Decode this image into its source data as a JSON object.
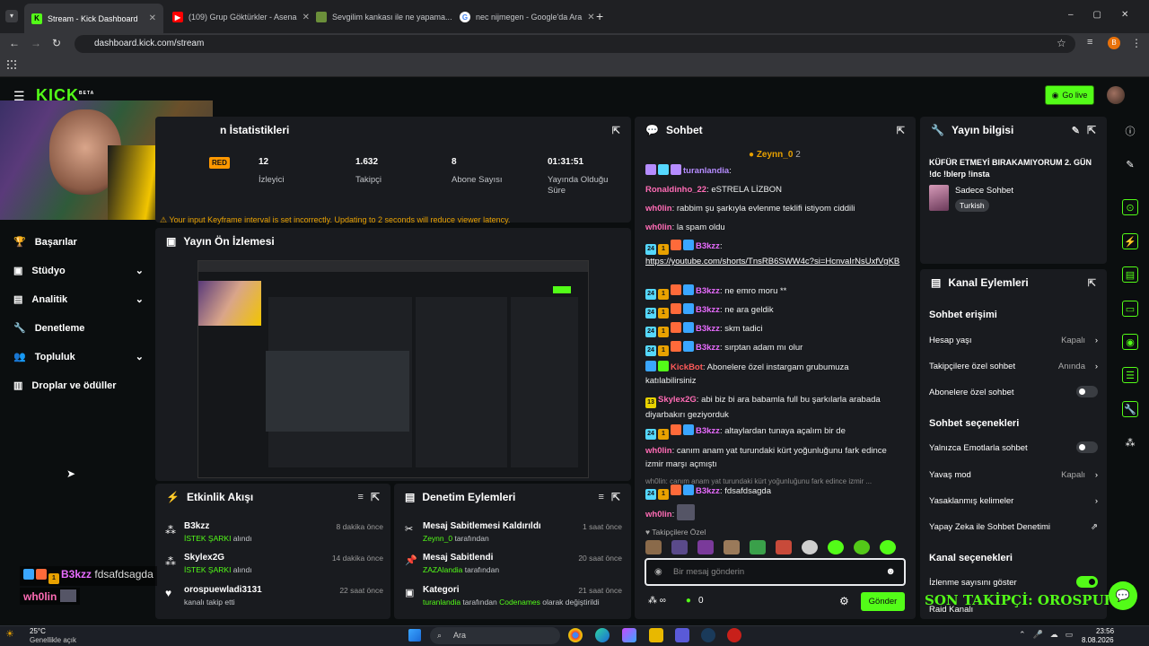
{
  "browser": {
    "tabs": [
      {
        "title": "Stream - Kick Dashboard",
        "active": true
      },
      {
        "title": "(109) Grup Göktürkler - Asena"
      },
      {
        "title": "Sevgilim kankası ile ne yapama..."
      },
      {
        "title": "nec nijmegen - Google'da Ara"
      }
    ],
    "url": "dashboard.kick.com/stream",
    "profile_initial": "B"
  },
  "header": {
    "logo": "KICK",
    "logo_sup": "BETA",
    "go_live": "Go live"
  },
  "sidebar": {
    "items": [
      {
        "label": "Başarılar"
      },
      {
        "label": "Stüdyo"
      },
      {
        "label": "Analitik"
      },
      {
        "label": "Denetleme"
      },
      {
        "label": "Topluluk"
      },
      {
        "label": "Droplar ve ödüller"
      }
    ]
  },
  "stats": {
    "title": "n İstatistikleri",
    "status": "RED",
    "items": [
      {
        "value": "12",
        "label": "İzleyici"
      },
      {
        "value": "1.632",
        "label": "Takipçi"
      },
      {
        "value": "8",
        "label": "Abone Sayısı"
      },
      {
        "value": "01:31:51",
        "label": "Yayında Olduğu Süre"
      }
    ],
    "warning": "Your input Keyframe interval is set incorrectly. Updating to 2 seconds will reduce viewer latency."
  },
  "preview": {
    "title": "Yayın Ön İzlemesi"
  },
  "activity": {
    "title": "Etkinlik Akışı",
    "rows": [
      {
        "name": "B3kzz",
        "time": "8 dakika önce",
        "hl": "İSTEK ŞARKI",
        "rest": " alındı"
      },
      {
        "name": "Skylex2G",
        "time": "14 dakika önce",
        "hl": "İSTEK ŞARKI",
        "rest": " alındı"
      },
      {
        "name": "orospuewladi3131",
        "time": "22 saat önce",
        "hl": "",
        "rest": "kanalı takip etti"
      }
    ]
  },
  "moderation": {
    "title": "Denetim Eylemleri",
    "rows": [
      {
        "name": "Mesaj Sabitlemesi Kaldırıldı",
        "time": "1 saat önce",
        "hl": "Zeynn_0",
        "rest": " tarafından"
      },
      {
        "name": "Mesaj Sabitlendi",
        "time": "20 saat önce",
        "hl": "ZAZAlandia",
        "rest": " tarafından"
      },
      {
        "name": "Kategori",
        "time": "21 saat önce",
        "hl": "turanlandia",
        "rest": " tarafından ",
        "hl2": "Codenames",
        "rest2": " olarak değiştirildi"
      }
    ]
  },
  "chat": {
    "title": "Sohbet",
    "pinned_user": "Zeynn_0",
    "pinned_count": "2",
    "messages": [
      {
        "user": "turanlandia",
        "text": ":",
        "color": "#b58cff"
      },
      {
        "user": "Ronaldinho_22",
        "text": ": eSTRELA LİZBON",
        "color": "#ff6cb5"
      },
      {
        "user": "wh0lin",
        "text": ": rabbim şu şarkıyla evlenme teklifi istiyom ciddili",
        "color": "#ff6cb5"
      },
      {
        "user": "wh0lin",
        "text": ": la spam oldu",
        "color": "#ff6cb5"
      },
      {
        "user": "B3kzz",
        "text": ":",
        "color": "#e86cff"
      },
      {
        "user": "B3kzz",
        "text": ": ne emro moru **",
        "color": "#e86cff"
      },
      {
        "user": "B3kzz",
        "text": ": ne ara geldik",
        "color": "#e86cff"
      },
      {
        "user": "B3kzz",
        "text": ": skm tadici",
        "color": "#e86cff"
      },
      {
        "user": "B3kzz",
        "text": ": sırptan adam mı olur",
        "color": "#e86cff"
      },
      {
        "user": "KickBot",
        "text": ": Abonelere özel instargam grubumuza katılabilirsiniz",
        "color": "#ff5a5a"
      },
      {
        "user": "Skylex2G",
        "text": ": abi biz bi ara babamla full bu şarkılarla arabada diyarbakırı geziyorduk",
        "color": "#ff6cb5"
      },
      {
        "user": "B3kzz",
        "text": ": altaylardan tunaya açalım bir de",
        "color": "#e86cff"
      },
      {
        "user": "wh0lin",
        "text": ": canım anam yat turundaki kürt yoğunluğunu fark edince izmir marşı açmıştı",
        "color": "#ff6cb5"
      },
      {
        "user": "B3kzz",
        "text": ": fdsafdsagda",
        "color": "#e86cff"
      },
      {
        "user": "wh0lin",
        "text": ":",
        "color": "#ff6cb5"
      }
    ],
    "link": "https://youtube.com/shorts/TnsRB6SWW4c?si=HcnvaIrNsUxfVgKB",
    "reply_text": "wh0lin: canım anam yat turundaki kürt yoğunluğunu fark edince izmir ...",
    "followers_only": "Takipçilere Özel",
    "input_placeholder": "Bir mesaj gönderin",
    "points": "0",
    "send": "Gönder"
  },
  "stream_info": {
    "title": "Yayın bilgisi",
    "stream_title": "KÜFÜR ETMEYİ BIRAKAMIYORUM 2. GÜN !dc !blerp !insta",
    "category": "Sadece Sohbet",
    "language": "Turkish"
  },
  "channel_actions": {
    "title": "Kanal Eylemleri",
    "chat_access": "Sohbet erişimi",
    "account_age": {
      "label": "Hesap yaşı",
      "value": "Kapalı"
    },
    "followers_chat": {
      "label": "Takipçilere özel sohbet",
      "value": "Anında"
    },
    "subs_chat": {
      "label": "Abonelere özel sohbet"
    },
    "chat_options": "Sohbet seçenekleri",
    "emotes_only": {
      "label": "Yalnızca Emotlarla sohbet"
    },
    "slow_mode": {
      "label": "Yavaş mod",
      "value": "Kapalı"
    },
    "banned_words": {
      "label": "Yasaklanmış kelimeler"
    },
    "ai_mod": {
      "label": "Yapay Zeka ile Sohbet Denetimi"
    },
    "channel_options": "Kanal seçenekleri",
    "viewer_count": {
      "label": "İzlenme sayısını göster"
    },
    "raid": {
      "label": "Raid Kanalı"
    }
  },
  "overlay": {
    "chat1_user": "B3kzz",
    "chat1_text": "fdsafdsagda",
    "chat2_user": "wh0lin",
    "last_follower": "SON TAKİPÇİ: OROSPUEWLADI3131"
  },
  "taskbar": {
    "weather_temp": "25°C",
    "weather_desc": "Genellikle açık",
    "search": "Ara",
    "time": "23:56",
    "date": "8.08.2026"
  },
  "colors": {
    "kick_green": "#53fc18",
    "panel": "#191b1f",
    "bg": "#0b0e0f"
  }
}
